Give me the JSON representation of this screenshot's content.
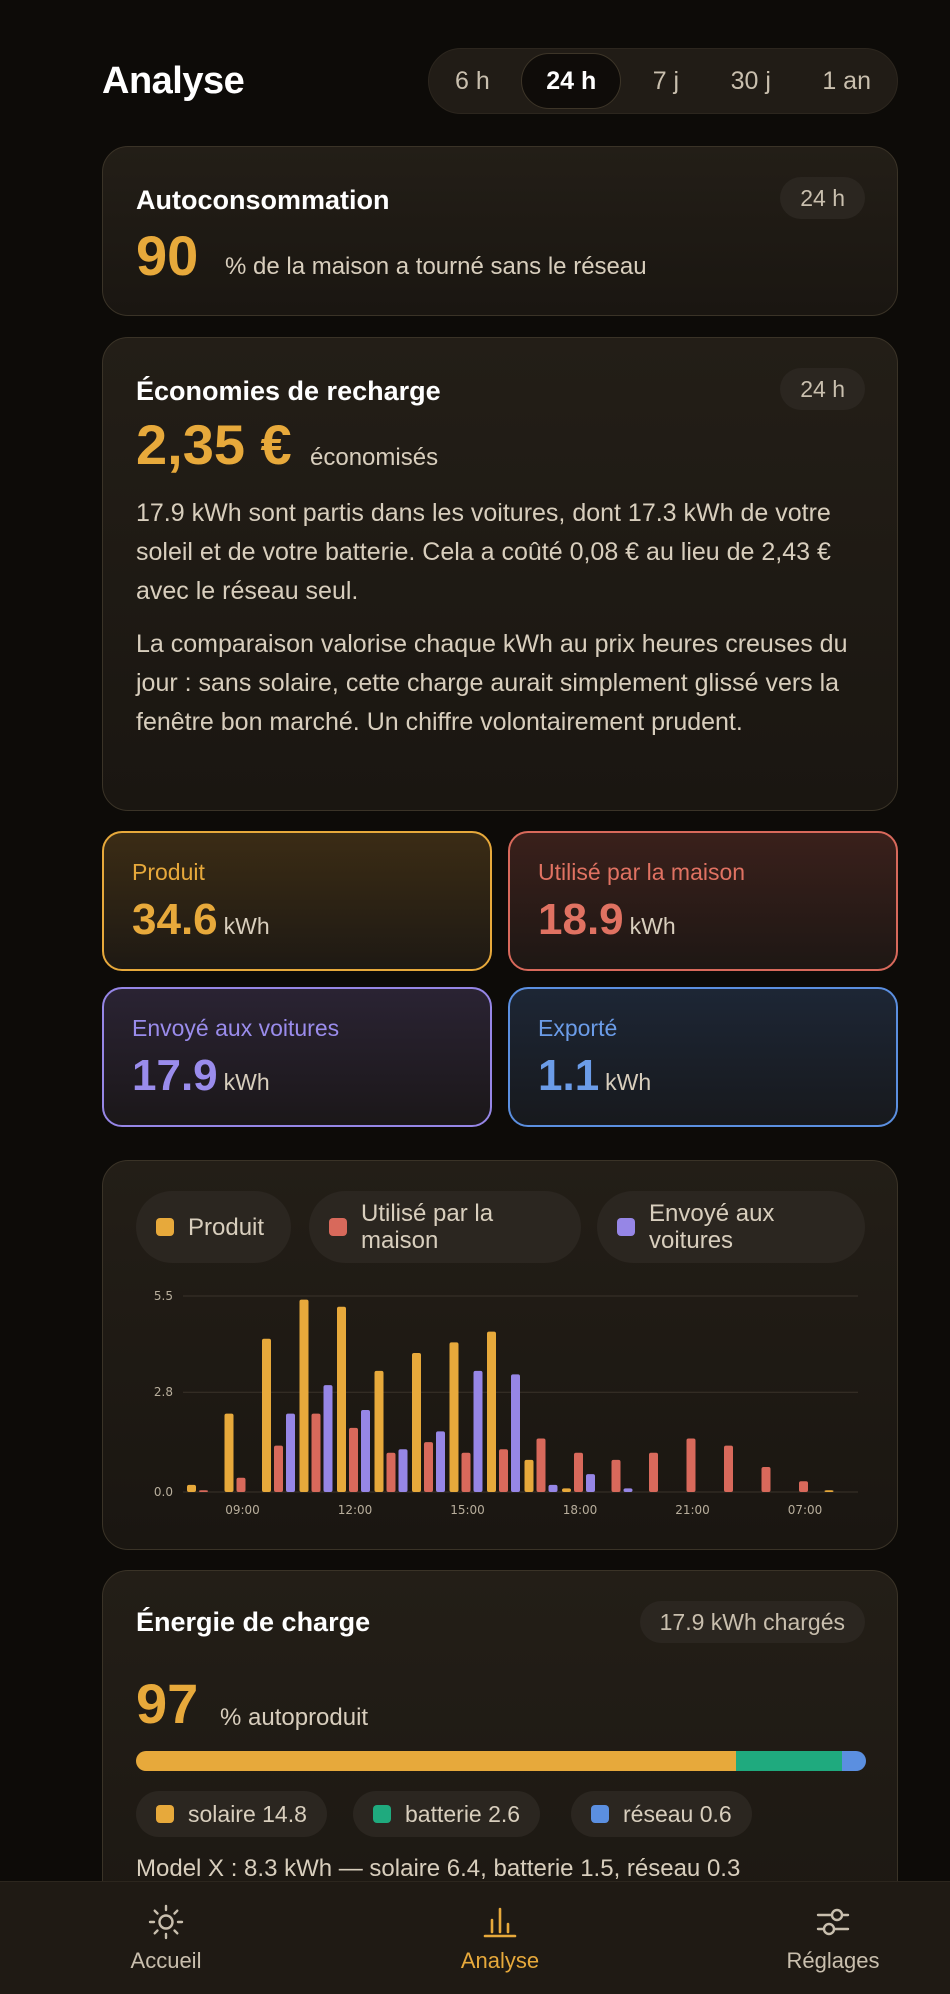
{
  "header": {
    "title": "Analyse",
    "ranges": [
      "6 h",
      "24 h",
      "7 j",
      "30 j",
      "1 an"
    ],
    "active_range": "24 h"
  },
  "autoconsommation": {
    "title": "Autoconsommation",
    "badge": "24 h",
    "value": "90",
    "suffix": "% de la maison a tourné sans le réseau"
  },
  "economies": {
    "title": "Économies de recharge",
    "badge": "24 h",
    "value": "2,35 €",
    "suffix": "économisés",
    "paragraph1": "17.9 kWh sont partis dans les voitures, dont 17.3 kWh de votre soleil et de votre batterie. Cela a coûté 0,08 € au lieu de 2,43 € avec le réseau seul.",
    "paragraph2": "La comparaison valorise chaque kWh au prix heures creuses du jour : sans solaire, cette charge aurait simplement glissé vers la fenêtre bon marché. Un chiffre volontairement prudent."
  },
  "tiles": {
    "produced": {
      "label": "Produit",
      "value": "34.6",
      "unit": "kWh"
    },
    "house": {
      "label": "Utilisé par la maison",
      "value": "18.9",
      "unit": "kWh"
    },
    "cars": {
      "label": "Envoyé aux voitures",
      "value": "17.9",
      "unit": "kWh"
    },
    "exported": {
      "label": "Exporté",
      "value": "1.1",
      "unit": "kWh"
    }
  },
  "colors": {
    "produced": "#e7a93b",
    "house": "#d8695b",
    "cars": "#9686e6",
    "exported": "#5b8fe0",
    "battery": "#1faa7e"
  },
  "chart_data": {
    "type": "bar",
    "ylim": [
      0,
      5.5
    ],
    "yticks": [
      "0.0",
      "2.8",
      "5.5"
    ],
    "xticks": [
      "09:00",
      "12:00",
      "15:00",
      "18:00",
      "21:00",
      "07:00"
    ],
    "xtick_index": [
      1,
      4,
      7,
      10,
      13,
      16
    ],
    "grid": true,
    "legend": [
      "Produit",
      "Utilisé par la maison",
      "Envoyé aux voitures"
    ],
    "series": [
      {
        "name": "Produit",
        "values": [
          0.2,
          2.2,
          4.3,
          5.4,
          5.2,
          3.4,
          3.9,
          4.2,
          4.5,
          0.9,
          0.1,
          0,
          0,
          0,
          0,
          0,
          0,
          0.05
        ]
      },
      {
        "name": "Utilisé par la maison",
        "values": [
          0.05,
          0.4,
          1.3,
          2.2,
          1.8,
          1.1,
          1.4,
          1.1,
          1.2,
          1.5,
          1.1,
          0.9,
          1.1,
          1.5,
          1.3,
          0.7,
          0.3
        ]
      },
      {
        "name": "Envoyé aux voitures",
        "values": [
          0,
          0,
          2.2,
          3.0,
          2.3,
          1.2,
          1.7,
          3.4,
          3.3,
          0.2,
          0.5,
          0.1,
          0,
          0,
          0,
          0,
          0,
          0
        ]
      }
    ]
  },
  "charge": {
    "title": "Énergie de charge",
    "badge": "17.9 kWh chargés",
    "value": "97",
    "suffix": "% autoproduit",
    "shares": {
      "solar": 14.8,
      "battery": 2.6,
      "grid": 0.6
    },
    "chip_solar": "solaire 14.8",
    "chip_battery": "batterie 2.6",
    "chip_grid": "réseau 0.6",
    "detail": "Model X : 8.3 kWh — solaire 6.4, batterie 1.5, réseau 0.3"
  },
  "nav": {
    "home": "Accueil",
    "analyse": "Analyse",
    "settings": "Réglages"
  }
}
